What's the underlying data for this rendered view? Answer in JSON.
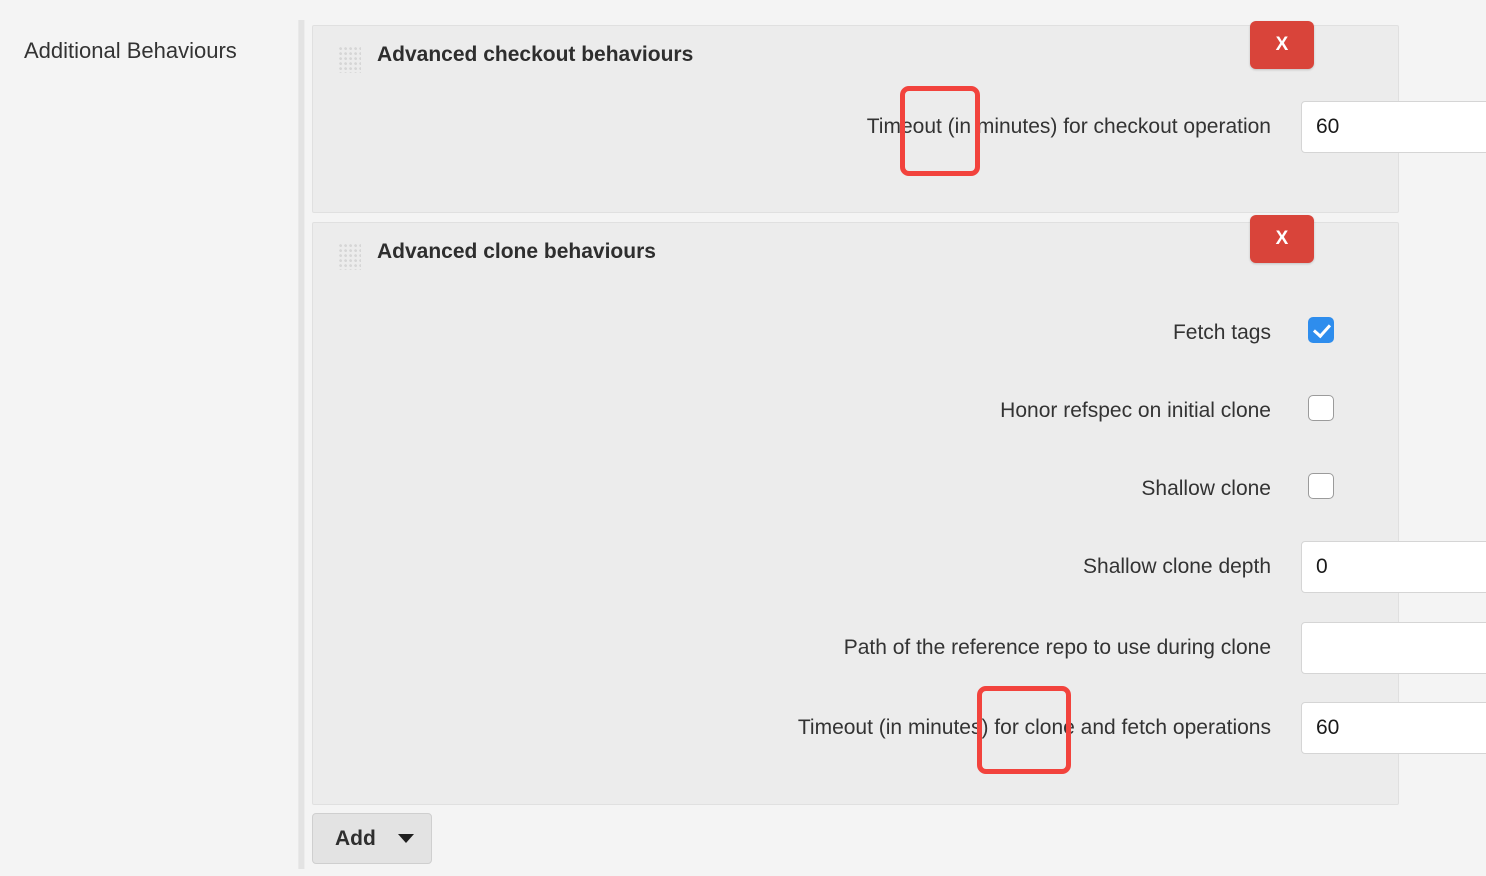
{
  "section": {
    "label": "Additional Behaviours"
  },
  "panels": [
    {
      "title": "Advanced checkout behaviours",
      "remove_label": "X",
      "drag_handle": "drag-handle-icon",
      "rows": [
        {
          "label": "Timeout (in minutes) for checkout operation",
          "type": "text",
          "value": "60",
          "placeholder": "",
          "help": "?",
          "highlighted": true
        }
      ]
    },
    {
      "title": "Advanced clone behaviours",
      "remove_label": "X",
      "drag_handle": "drag-handle-icon",
      "rows": [
        {
          "label": "Fetch tags",
          "type": "checkbox",
          "checked": true,
          "help": "?",
          "highlighted": false
        },
        {
          "label": "Honor refspec on initial clone",
          "type": "checkbox",
          "checked": false,
          "help": "?",
          "highlighted": false
        },
        {
          "label": "Shallow clone",
          "type": "checkbox",
          "checked": false,
          "help": "?",
          "highlighted": false
        },
        {
          "label": "Shallow clone depth",
          "type": "text",
          "value": "0",
          "placeholder": "",
          "help": "?",
          "highlighted": false
        },
        {
          "label": "Path of the reference repo to use during clone",
          "type": "text",
          "value": "",
          "placeholder": "",
          "help": "?",
          "highlighted": false
        },
        {
          "label": "Timeout (in minutes) for clone and fetch operations",
          "type": "text",
          "value": "60",
          "placeholder": "",
          "help": "?",
          "highlighted": true
        }
      ]
    }
  ],
  "add_button": {
    "label": "Add",
    "caret": "chevron-down-icon"
  },
  "colors": {
    "page_background": "#f4f4f4",
    "panel_background": "#ececec",
    "remove_button": "#d9443a",
    "checkbox_checked": "#2e8ded",
    "annotation_highlight": "#f2433d",
    "help_icon": "#4a7fb5"
  }
}
